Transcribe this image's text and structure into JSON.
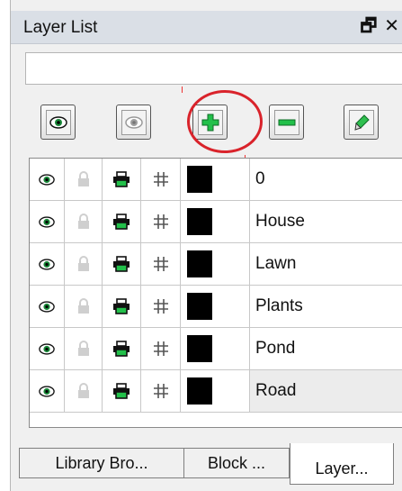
{
  "panel": {
    "title": "Layer List",
    "float_glyph": "🗗",
    "close_glyph": "✕"
  },
  "search": {
    "value": "",
    "placeholder": ""
  },
  "toolbar": [
    {
      "name": "show-all-layers-button",
      "icon": "eye-icon"
    },
    {
      "name": "hide-layers-button",
      "icon": "eye-gray-icon"
    },
    {
      "name": "add-layer-button",
      "icon": "plus-icon",
      "highlighted": true
    },
    {
      "name": "remove-layer-button",
      "icon": "minus-icon"
    },
    {
      "name": "edit-layer-button",
      "icon": "pen-icon"
    }
  ],
  "layers": [
    {
      "name": "0",
      "color": "#000000"
    },
    {
      "name": "House",
      "color": "#000000"
    },
    {
      "name": "Lawn",
      "color": "#000000"
    },
    {
      "name": "Plants",
      "color": "#000000"
    },
    {
      "name": "Pond",
      "color": "#000000"
    },
    {
      "name": "Road",
      "color": "#000000",
      "selected": true
    }
  ],
  "tabs": [
    {
      "label": "Library Bro...",
      "active": false
    },
    {
      "label": "Block ...",
      "active": false
    },
    {
      "label": "Layer...",
      "active": true
    }
  ],
  "colors": {
    "accent_green": "#22b04a",
    "highlight_red": "#d9232b"
  }
}
